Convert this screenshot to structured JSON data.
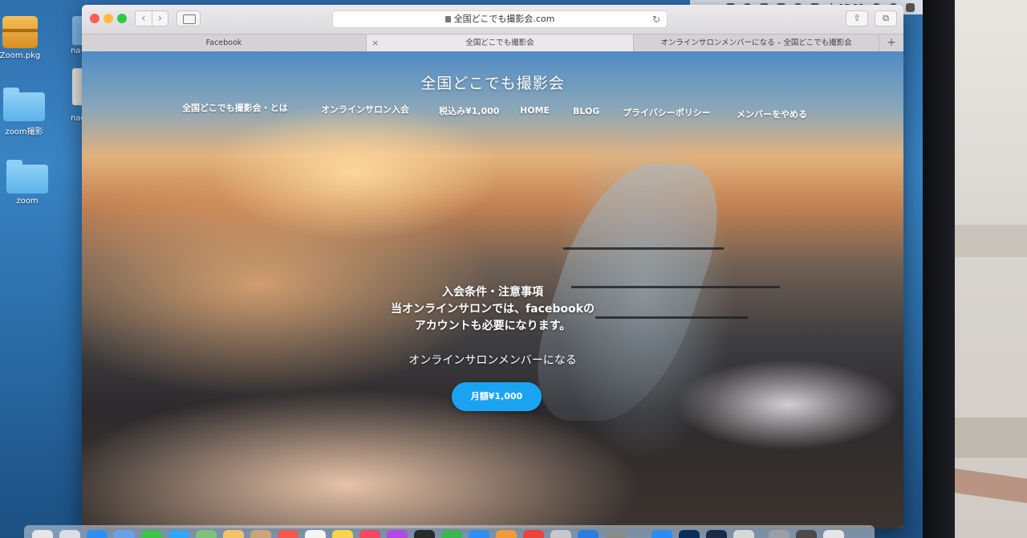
{
  "menubar": {
    "clock": "土 17:25"
  },
  "desktop": {
    "icons": [
      {
        "label": "Zoom.pkg"
      },
      {
        "label": "zoom撮影"
      },
      {
        "label": "zoom"
      }
    ],
    "partial_labels": [
      "na",
      "nag"
    ]
  },
  "browser": {
    "url": "全国どこでも撮影会.com",
    "tabs": [
      {
        "label": "Facebook"
      },
      {
        "label": "全国どこでも撮影会"
      },
      {
        "label": "オンラインサロンメンバーになる – 全国どこでも撮影会"
      }
    ]
  },
  "site": {
    "title": "全国どこでも撮影会",
    "nav": [
      {
        "label": "全国どこでも撮影会・とは"
      },
      {
        "label": "オンラインサロン入会"
      },
      {
        "label": "税込み¥1,000"
      },
      {
        "label": "HOME"
      },
      {
        "label": "BLOG"
      },
      {
        "label": "プライバシーポリシー"
      },
      {
        "label": "メンバーをやめる"
      }
    ],
    "notice_lines": [
      "入会条件・注意事項",
      "当オンラインサロンでは、facebookの",
      "アカウントも必要になります。"
    ],
    "join_text": "オンラインサロンメンバーになる",
    "cta_label": "月額¥1,000",
    "cta_color": "#1aa3f0"
  }
}
